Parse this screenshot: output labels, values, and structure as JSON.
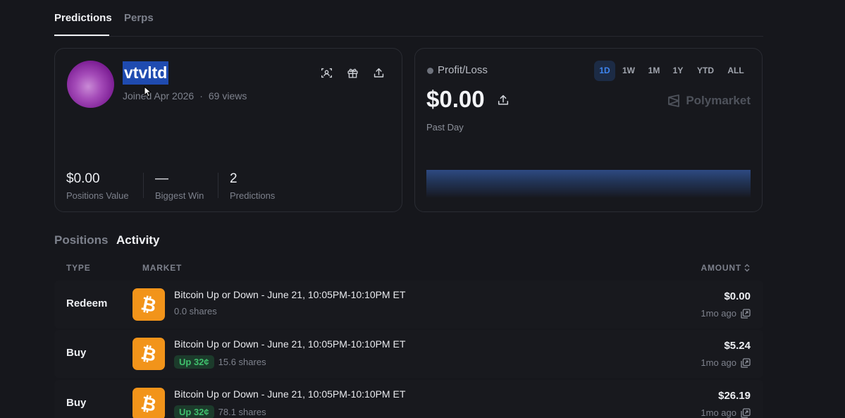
{
  "top_tabs": [
    {
      "label": "Predictions",
      "active": true
    },
    {
      "label": "Perps",
      "active": false
    }
  ],
  "profile": {
    "username": "vtvltd",
    "joined": "Joined Apr 2026",
    "views": "69 views",
    "icons": [
      "scan-icon",
      "gift-icon",
      "share-icon"
    ],
    "stats": [
      {
        "value": "$0.00",
        "label": "Positions Value"
      },
      {
        "value": "—",
        "label": "Biggest Win"
      },
      {
        "value": "2",
        "label": "Predictions"
      }
    ]
  },
  "profit_loss": {
    "title": "Profit/Loss",
    "value": "$0.00",
    "period": "Past Day",
    "brand": "Polymarket",
    "ranges": [
      {
        "label": "1D",
        "active": true
      },
      {
        "label": "1W",
        "active": false
      },
      {
        "label": "1M",
        "active": false
      },
      {
        "label": "1Y",
        "active": false
      },
      {
        "label": "YTD",
        "active": false
      },
      {
        "label": "ALL",
        "active": false
      }
    ]
  },
  "section_tabs": [
    {
      "label": "Positions",
      "active": false
    },
    {
      "label": "Activity",
      "active": true
    }
  ],
  "activity": {
    "columns": {
      "type": "TYPE",
      "market": "MARKET",
      "amount": "AMOUNT"
    },
    "rows": [
      {
        "type": "Redeem",
        "market": "Bitcoin Up or Down - June 21, 10:05PM-10:10PM ET",
        "badge": "",
        "shares": "0.0 shares",
        "amount": "$0.00",
        "when": "1mo ago"
      },
      {
        "type": "Buy",
        "market": "Bitcoin Up or Down - June 21, 10:05PM-10:10PM ET",
        "badge": "Up 32¢",
        "shares": "15.6 shares",
        "amount": "$5.24",
        "when": "1mo ago"
      },
      {
        "type": "Buy",
        "market": "Bitcoin Up or Down - June 21, 10:05PM-10:10PM ET",
        "badge": "Up 32¢",
        "shares": "78.1 shares",
        "amount": "$26.19",
        "when": "1mo ago"
      }
    ]
  },
  "colors": {
    "background": "#16171c",
    "accent_blue": "#3e85f0",
    "selection": "#1f4bb0",
    "bitcoin": "#f2941a",
    "up_green": "#3fbf6c"
  }
}
